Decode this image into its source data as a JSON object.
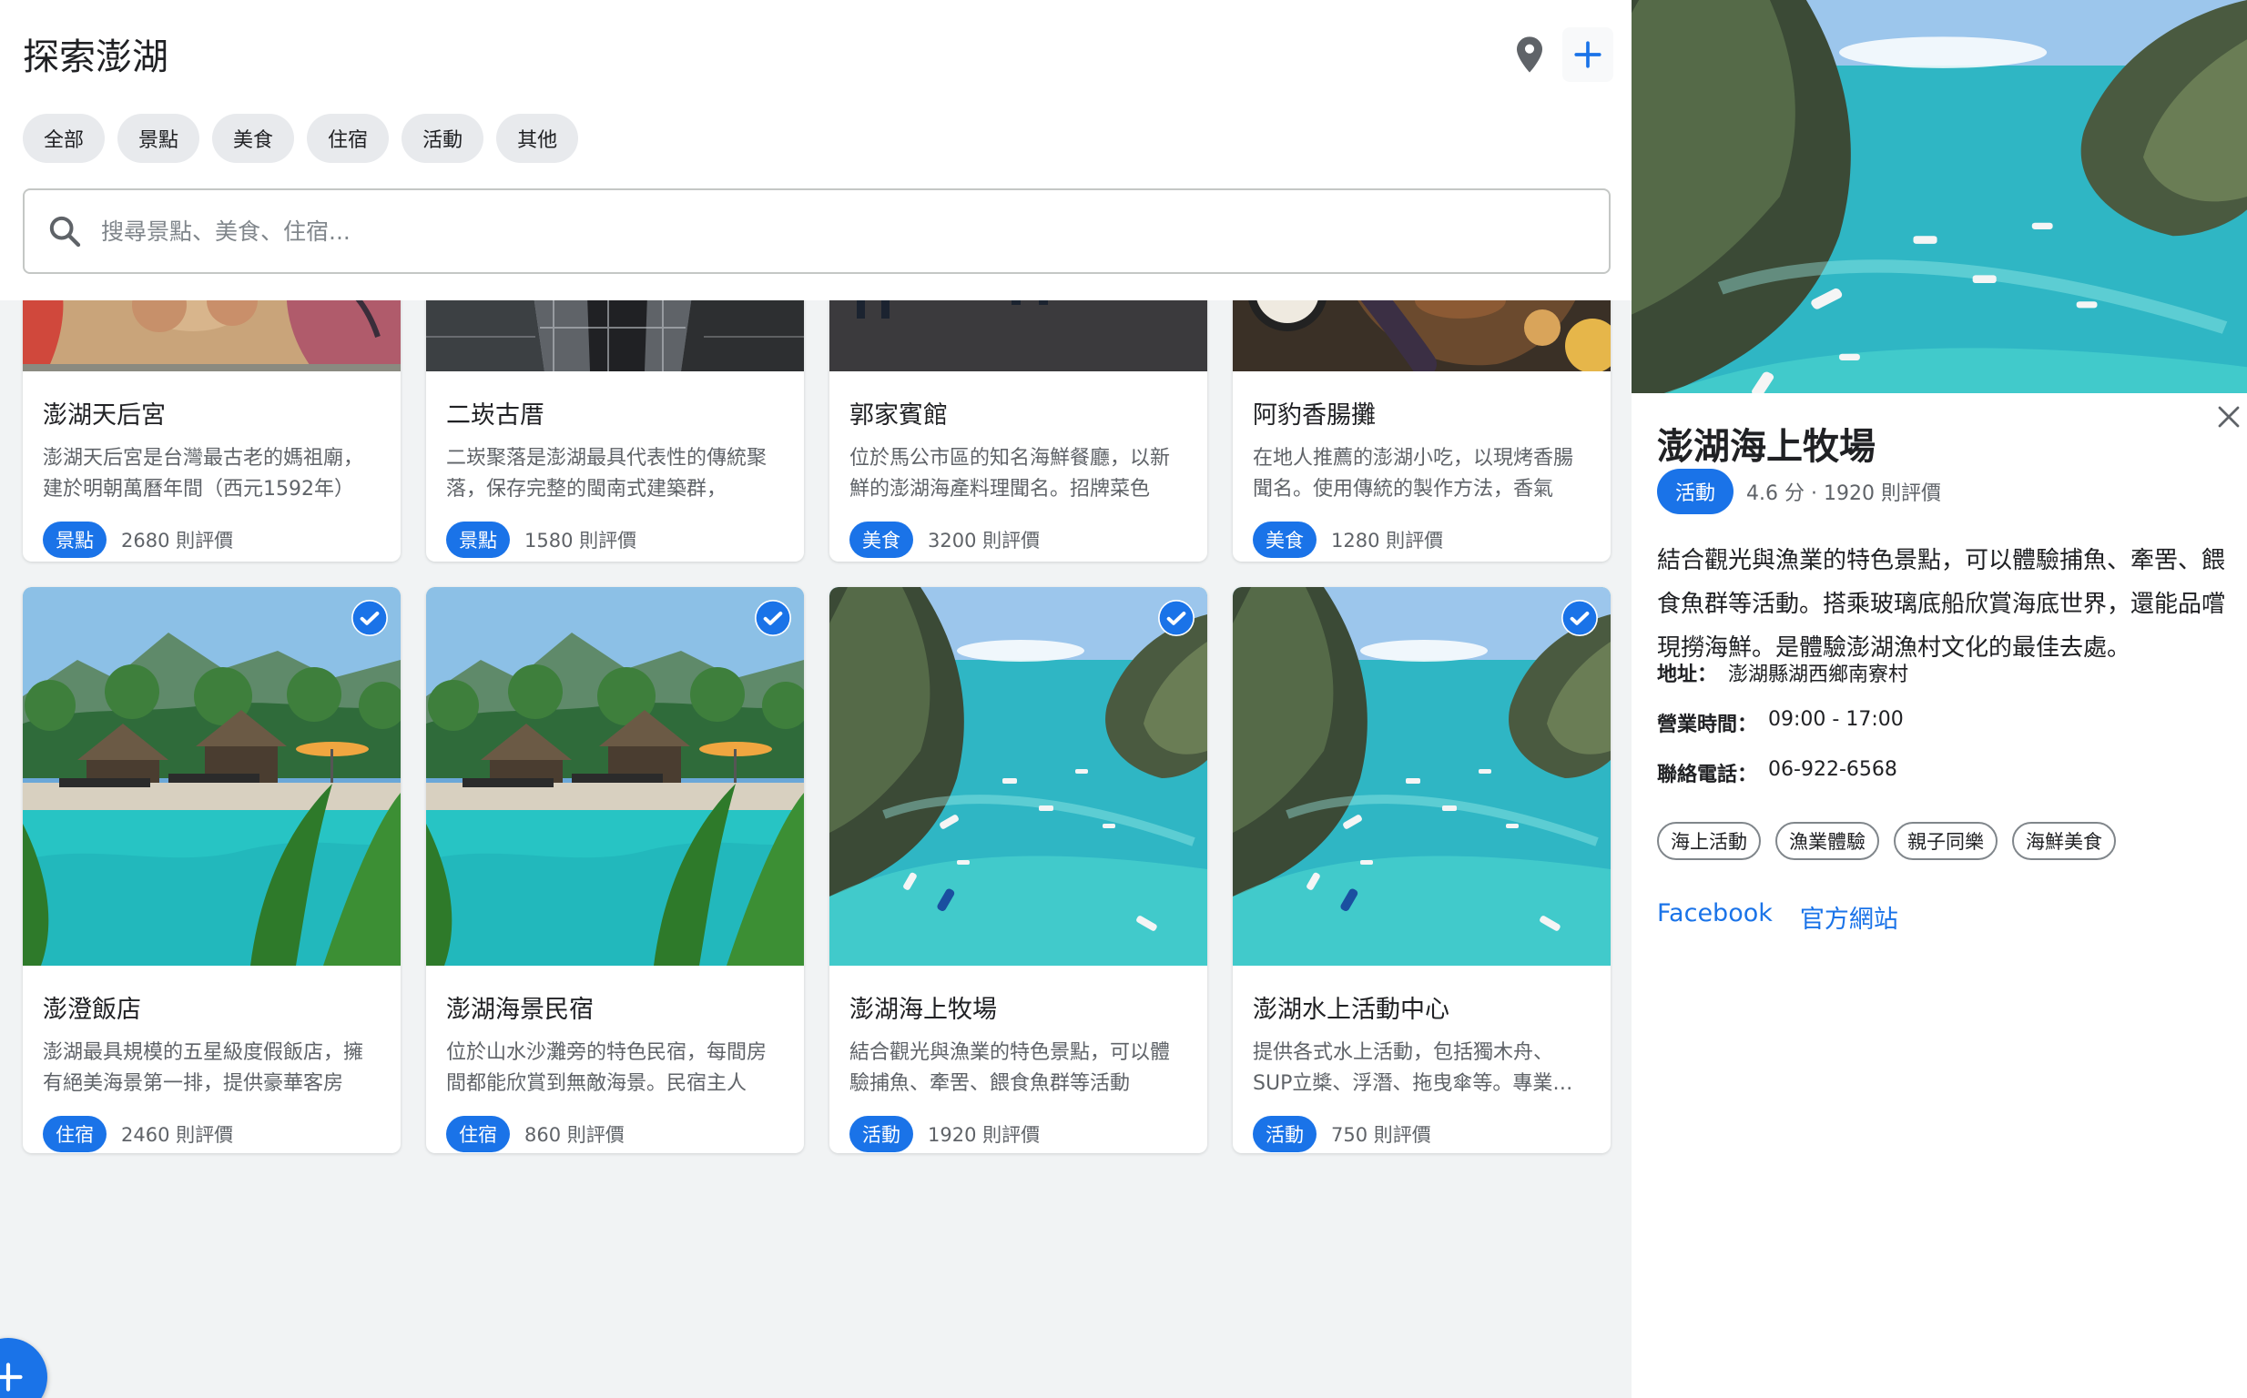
{
  "header": {
    "title": "探索澎湖",
    "pin_icon": "location-pin-icon",
    "add_icon": "plus-icon"
  },
  "filters": [
    "全部",
    "景點",
    "美食",
    "住宿",
    "活動",
    "其他"
  ],
  "search": {
    "placeholder": "搜尋景點、美食、住宿..."
  },
  "cards": [
    {
      "title": "澎湖天后宮",
      "desc": "澎湖天后宮是台灣最古老的媽祖廟，建於明朝萬曆年間（西元1592年）",
      "category": "景點",
      "reviews": "2680 則評價",
      "image": "mural"
    },
    {
      "title": "二崁古厝",
      "desc": "二崁聚落是澎湖最具代表性的傳統聚落，保存完整的閩南式建築群，",
      "category": "景點",
      "reviews": "1580 則評價",
      "image": "skyscraper"
    },
    {
      "title": "郭家賓館",
      "desc": "位於馬公市區的知名海鮮餐廳，以新鮮的澎湖海產料理聞名。招牌菜色",
      "category": "美食",
      "reviews": "3200 則評價",
      "image": "restaurant"
    },
    {
      "title": "阿豹香腸攤",
      "desc": "在地人推薦的澎湖小吃，以現烤香腸聞名。使用傳統的製作方法，香氣",
      "category": "美食",
      "reviews": "1280 則評價",
      "image": "bbq"
    },
    {
      "title": "澎澄飯店",
      "desc": "澎湖最具規模的五星級度假飯店，擁有絕美海景第一排，提供豪華客房",
      "category": "住宿",
      "reviews": "2460 則評價",
      "image": "resort",
      "checked": true
    },
    {
      "title": "澎湖海景民宿",
      "desc": "位於山水沙灘旁的特色民宿，每間房間都能欣賞到無敵海景。民宿主人",
      "category": "住宿",
      "reviews": "860 則評價",
      "image": "resort",
      "checked": true
    },
    {
      "title": "澎湖海上牧場",
      "desc": "結合觀光與漁業的特色景點，可以體驗捕魚、牽罟、餵食魚群等活動",
      "category": "活動",
      "reviews": "1920 則評價",
      "image": "lagoon",
      "checked": true
    },
    {
      "title": "澎湖水上活動中心",
      "desc": "提供各式水上活動，包括獨木舟、SUP立槳、浮潛、拖曳傘等。專業教練",
      "category": "活動",
      "reviews": "750 則評價",
      "image": "lagoon",
      "checked": true
    }
  ],
  "detail": {
    "title": "澎湖海上牧場",
    "category": "活動",
    "rating": "4.6 分 · 1920 則評價",
    "description": "結合觀光與漁業的特色景點，可以體驗捕魚、牽罟、餵食魚群等活動。搭乘玻璃底船欣賞海底世界，還能品嚐現撈海鮮。是體驗澎湖漁村文化的最佳去處。",
    "address_label": "地址：",
    "address": "澎湖縣湖西鄉南寮村",
    "hours_label": "營業時間：",
    "hours": "09:00 - 17:00",
    "phone_label": "聯絡電話：",
    "phone": "06-922-6568",
    "tags": [
      "海上活動",
      "漁業體驗",
      "親子同樂",
      "海鮮美食"
    ],
    "links": [
      "Facebook",
      "官方網站"
    ]
  },
  "colors": {
    "accent": "#1a73e8",
    "chip_bg": "#e8eaed",
    "page_bg": "#f1f3f4"
  }
}
